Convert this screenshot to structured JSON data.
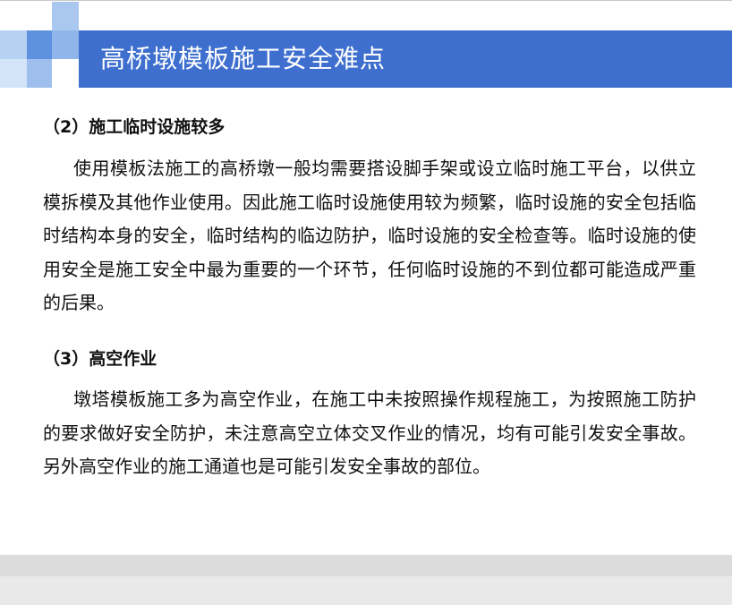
{
  "slide": {
    "title": "高桥墩模板施工安全难点",
    "sections": [
      {
        "heading": "（2）施工临时设施较多",
        "paragraph": "使用模板法施工的高桥墩一般均需要搭设脚手架或设立临时施工平台，以供立模拆模及其他作业使用。因此施工临时设施使用较为频繁，临时设施的安全包括临时结构本身的安全，临时结构的临边防护，临时设施的安全检查等。临时设施的使用安全是施工安全中最为重要的一个环节，任何临时设施的不到位都可能造成严重的后果。"
      },
      {
        "heading": "（3）高空作业",
        "paragraph": "墩塔模板施工多为高空作业，在施工中未按照操作规程施工，为按照施工防护的要求做好安全防护，未注意高空立体交叉作业的情况，均有可能引发安全事故。另外高空作业的施工通道也是可能引发安全事故的部位。"
      }
    ]
  },
  "colors": {
    "title_bar": "#3e6fcf",
    "deco_squares": [
      "#a9c7ef",
      "#b7d1f3",
      "#5e92df",
      "#8fb5ea",
      "#d4e4f8",
      "#9ebfed"
    ],
    "text": "#111111",
    "page_background": "#e9e9e9"
  }
}
